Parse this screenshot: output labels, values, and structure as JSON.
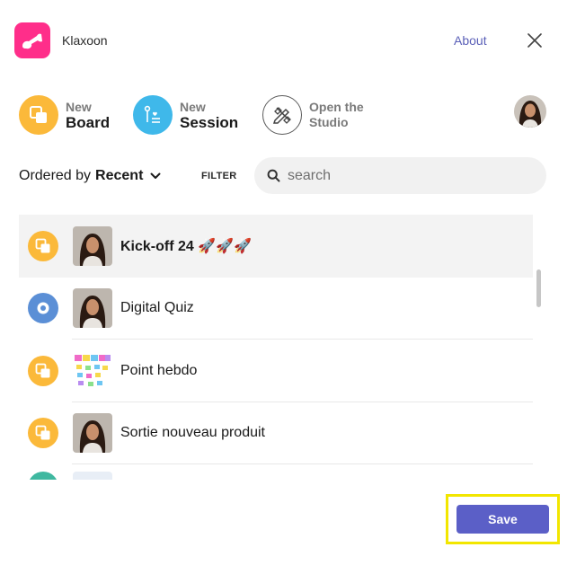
{
  "header": {
    "app_name": "Klaxoon",
    "about_label": "About"
  },
  "actions": {
    "board": {
      "line1": "New",
      "line2": "Board",
      "icon": "board-icon",
      "color": "#fbb93a"
    },
    "session": {
      "line1": "New",
      "line2": "Session",
      "icon": "session-icon",
      "color": "#3fb8ea"
    },
    "studio": {
      "line1": "Open the",
      "line2": "Studio",
      "icon": "studio-icon"
    }
  },
  "filters": {
    "order_prefix": "Ordered by",
    "order_value": "Recent",
    "filter_label": "FILTER",
    "search_placeholder": "search",
    "search_value": ""
  },
  "items": [
    {
      "title": "Kick-off 24 🚀🚀🚀",
      "type": "board",
      "thumb": "person-photo",
      "selected": true
    },
    {
      "title": "Digital Quiz",
      "type": "quiz",
      "thumb": "person-photo",
      "selected": false
    },
    {
      "title": "Point hebdo",
      "type": "board",
      "thumb": "sticky-notes",
      "selected": false
    },
    {
      "title": "Sortie nouveau produit",
      "type": "board",
      "thumb": "person-photo",
      "selected": false
    }
  ],
  "footer": {
    "save_label": "Save"
  },
  "colors": {
    "brand": "#ff2e8a",
    "accent": "#5b5fc7",
    "board": "#fbb93a",
    "quiz": "#5b8fd6",
    "highlight": "#f2e600"
  }
}
